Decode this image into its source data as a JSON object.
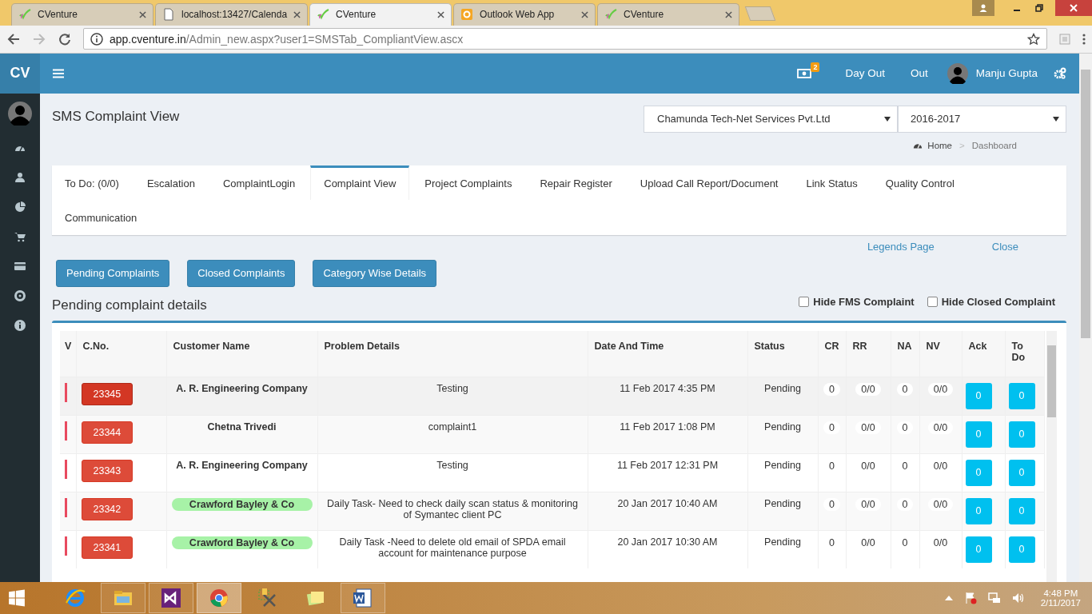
{
  "browser": {
    "tabs": [
      {
        "kind": "cventure",
        "title": "CVenture",
        "selected": false
      },
      {
        "kind": "page",
        "title": "localhost:13427/Calenda",
        "selected": false
      },
      {
        "kind": "cventure",
        "title": "CVenture",
        "selected": true
      },
      {
        "kind": "outlook",
        "title": "Outlook Web App",
        "selected": false
      },
      {
        "kind": "cventure",
        "title": "CVenture",
        "selected": false
      }
    ],
    "address": {
      "host": "app.cventure.in",
      "path": "/Admin_new.aspx?user1=SMSTab_CompliantView.ascx"
    }
  },
  "app": {
    "logo": "CV",
    "notification_count": "2",
    "header_links": [
      "Day Out",
      "Out"
    ],
    "user_name": "Manju Gupta"
  },
  "page_title": "SMS Complaint View",
  "company_select": {
    "value": "Chamunda Tech-Net Services Pvt.Ltd"
  },
  "year_select": {
    "value": "2016-2017"
  },
  "breadcrumb": {
    "items": [
      "Home",
      "Dashboard"
    ],
    "separator": ">"
  },
  "tabs": [
    {
      "label": "To Do: (0/0)",
      "selected": false
    },
    {
      "label": "Escalation",
      "selected": false
    },
    {
      "label": "ComplaintLogin",
      "selected": false
    },
    {
      "label": "Complaint View",
      "selected": true
    },
    {
      "label": "Project Complaints",
      "selected": false
    },
    {
      "label": "Repair Register",
      "selected": false
    },
    {
      "label": "Upload Call Report/Document",
      "selected": false
    },
    {
      "label": "Link Status",
      "selected": false
    },
    {
      "label": "Quality Control",
      "selected": false
    },
    {
      "label": "Communication",
      "selected": false
    }
  ],
  "links": [
    "Legends Page",
    "Close"
  ],
  "buttons": [
    "Pending Complaints",
    "Closed Complaints",
    "Category Wise Details"
  ],
  "section_title": "Pending complaint details",
  "filters": [
    {
      "label": "Hide FMS Complaint",
      "checked": false
    },
    {
      "label": "Hide Closed Complaint",
      "checked": false
    }
  ],
  "table": {
    "columns": [
      "V",
      "C.No.",
      "Customer Name",
      "Problem Details",
      "Date And Time",
      "Status",
      "CR",
      "RR",
      "NA",
      "NV",
      "Ack",
      "To Do"
    ],
    "rows": [
      {
        "highlighted": true,
        "number": "23345",
        "customer": "A. R. Engineering Company",
        "kind": "plain",
        "problem": "Testing",
        "date": "11 Feb 2017 4:35 PM",
        "status": "Pending",
        "cr": "0",
        "rr": "0/0",
        "na": "0",
        "nv": "0/0",
        "ack": "0",
        "todo": "0"
      },
      {
        "highlighted": false,
        "number": "23344",
        "customer": "Chetna Trivedi",
        "kind": "plain",
        "problem": "complaint1",
        "date": "11 Feb 2017 1:08 PM",
        "status": "Pending",
        "cr": "0",
        "rr": "0/0",
        "na": "0",
        "nv": "0/0",
        "ack": "0",
        "todo": "0"
      },
      {
        "highlighted": false,
        "number": "23343",
        "customer": "A. R. Engineering Company",
        "kind": "plain",
        "problem": "Testing",
        "date": "11 Feb 2017 12:31 PM",
        "status": "Pending",
        "cr": "0",
        "rr": "0/0",
        "na": "0",
        "nv": "0/0",
        "ack": "0",
        "todo": "0"
      },
      {
        "highlighted": false,
        "number": "23342",
        "customer": "Crawford Bayley & Co",
        "kind": "tag",
        "problem": "Daily Task- Need to check daily scan status & monitoring of Symantec client PC",
        "date": "20 Jan 2017 10:40 AM",
        "status": "Pending",
        "cr": "0",
        "rr": "0/0",
        "na": "0",
        "nv": "0/0",
        "ack": "0",
        "todo": "0"
      },
      {
        "highlighted": false,
        "number": "23341",
        "customer": "Crawford Bayley & Co",
        "kind": "tag",
        "problem": "Daily Task -Need to delete old email of SPDA email account for maintenance purpose",
        "date": "20 Jan 2017 10:30 AM",
        "status": "Pending",
        "cr": "0",
        "rr": "0/0",
        "na": "0",
        "nv": "0/0",
        "ack": "0",
        "todo": "0"
      }
    ]
  },
  "taskbar": {
    "apps": [
      {
        "kind": "ie",
        "running": false,
        "selected": false
      },
      {
        "kind": "explorer",
        "running": true,
        "selected": false
      },
      {
        "kind": "studio",
        "running": true,
        "selected": false
      },
      {
        "kind": "chrome",
        "running": true,
        "selected": true
      },
      {
        "kind": "tools",
        "running": false,
        "selected": false
      },
      {
        "kind": "notes",
        "running": false,
        "selected": false
      },
      {
        "kind": "word",
        "running": true,
        "selected": false
      }
    ],
    "clock": {
      "time": "4:48 PM",
      "date": "2/11/2017"
    }
  }
}
